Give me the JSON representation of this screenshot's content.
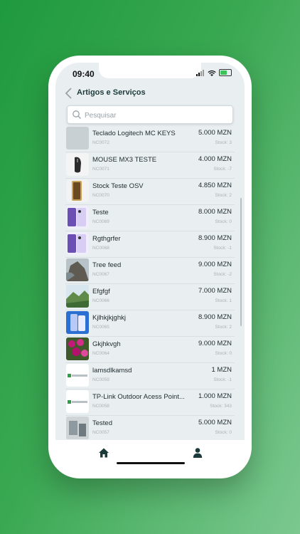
{
  "status_bar": {
    "time": "09:40"
  },
  "header": {
    "title": "Artigos e Serviços"
  },
  "search": {
    "placeholder": "Pesquisar"
  },
  "items": [
    {
      "name": "Teclado Logitech MC KEYS",
      "code": "NC0072",
      "price": "5.000 MZN",
      "stock": "Stock: 3",
      "thumb": "placeholder"
    },
    {
      "name": "MOUSE MX3 TESTE",
      "code": "NC0071",
      "price": "4.000 MZN",
      "stock": "Stock: -7",
      "thumb": "mouse"
    },
    {
      "name": "Stock Teste OSV",
      "code": "NC0070",
      "price": "4.850 MZN",
      "stock": "Stock: 2",
      "thumb": "phone-gold"
    },
    {
      "name": "Teste",
      "code": "NC0069",
      "price": "8.000 MZN",
      "stock": "Stock: 0",
      "thumb": "phone-purple"
    },
    {
      "name": "Rgthgrfer",
      "code": "NC0068",
      "price": "8.900 MZN",
      "stock": "Stock: -1",
      "thumb": "phone-purple"
    },
    {
      "name": "Tree feed",
      "code": "NC0067",
      "price": "9.000 MZN",
      "stock": "Stock: -2",
      "thumb": "landscape-rock"
    },
    {
      "name": "Efgfgf",
      "code": "NC0066",
      "price": "7.000 MZN",
      "stock": "Stock: 1",
      "thumb": "landscape-green"
    },
    {
      "name": "Kjlhkjkjghkj",
      "code": "NC0065",
      "price": "8.900 MZN",
      "stock": "Stock: 2",
      "thumb": "phone-blue"
    },
    {
      "name": "Gkjhkvgh",
      "code": "NC0064",
      "price": "9.000 MZN",
      "stock": "Stock: 0",
      "thumb": "flowers"
    },
    {
      "name": "lamsdlkamsd",
      "code": "NC0059",
      "price": "1 MZN",
      "stock": "Stock: -1",
      "thumb": "logo"
    },
    {
      "name": "TP-Link Outdoor Acess Point...",
      "code": "NC0058",
      "price": "1.000 MZN",
      "stock": "Stock: 343",
      "thumb": "logo"
    },
    {
      "name": "Tested",
      "code": "NC0057",
      "price": "5.000 MZN",
      "stock": "Stock: 0",
      "thumb": "room"
    }
  ],
  "colors": {
    "accent": "#1d3a3a",
    "background_start": "#1f9a3d",
    "background_end": "#7cc890"
  },
  "icons": {
    "back": "chevron-left-icon",
    "search": "search-icon",
    "home": "home-icon",
    "user": "user-icon"
  }
}
